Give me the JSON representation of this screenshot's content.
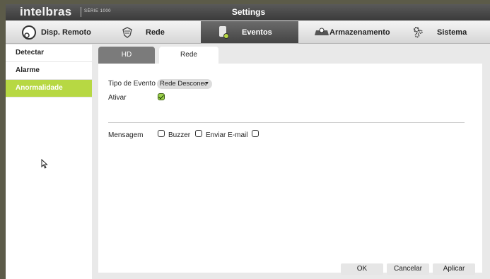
{
  "brand": {
    "name": "intelbras",
    "series": "SÉRIE 1000"
  },
  "window": {
    "title": "Settings"
  },
  "nav": {
    "items": [
      {
        "label": "Disp. Remoto",
        "icon": "remote-device-icon"
      },
      {
        "label": "Rede",
        "icon": "network-icon"
      },
      {
        "label": "Eventos",
        "icon": "events-icon",
        "active": true
      },
      {
        "label": "Armazenamento",
        "icon": "storage-icon"
      },
      {
        "label": "Sistema",
        "icon": "gears-icon"
      }
    ]
  },
  "sidebar": {
    "items": [
      {
        "label": "Detectar"
      },
      {
        "label": "Alarme"
      },
      {
        "label": "Anormalidade",
        "active": true
      }
    ]
  },
  "tabs": [
    {
      "label": "HD"
    },
    {
      "label": "Rede",
      "active": true
    }
  ],
  "form": {
    "event_type_label": "Tipo de Evento",
    "event_type_value": "Rede Desconec",
    "enable_label": "Ativar",
    "enable_checked": true,
    "message_label": "Mensagem",
    "buzzer_label": "Buzzer",
    "email_label": "Enviar E-mail"
  },
  "buttons": {
    "ok": "OK",
    "cancel": "Cancelar",
    "apply": "Aplicar"
  },
  "colors": {
    "accent": "#b7d843",
    "active_nav": "#555555",
    "tab_inactive": "#7b7b7b"
  }
}
